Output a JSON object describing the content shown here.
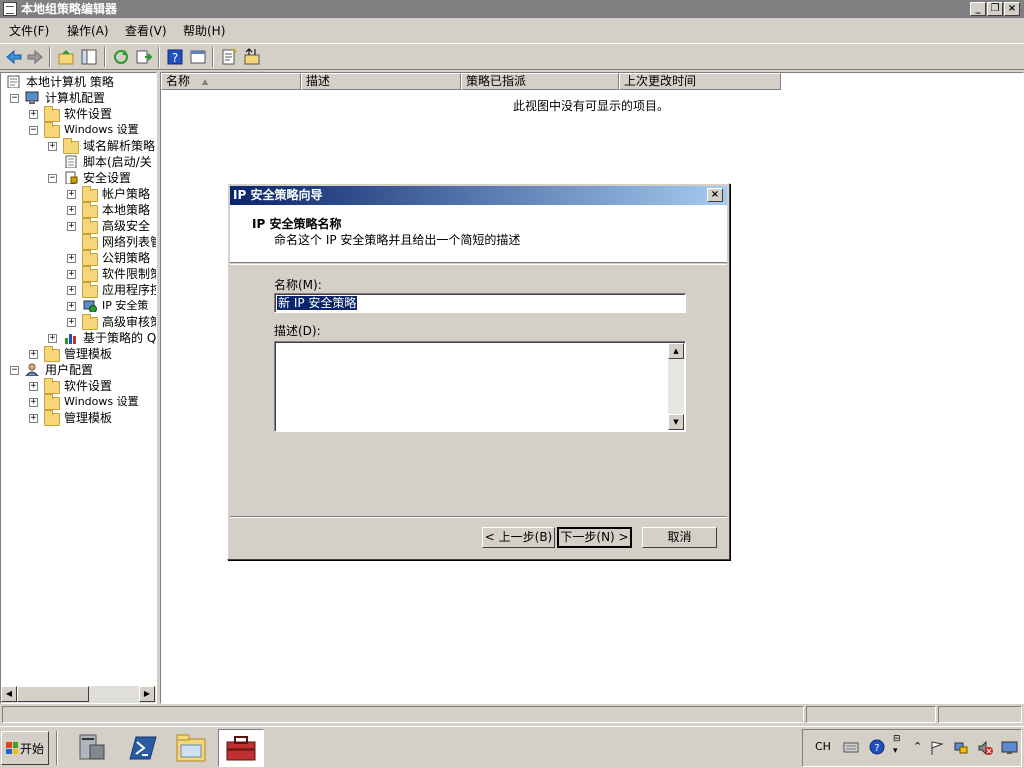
{
  "window": {
    "title": "本地组策略编辑器"
  },
  "menu": [
    "文件(F)",
    "操作(A)",
    "查看(V)",
    "帮助(H)"
  ],
  "tree": {
    "root": "本地计算机 策略",
    "items": [
      {
        "label": "计算机配置",
        "toggle": "−"
      },
      {
        "label": "软件设置",
        "toggle": "+"
      },
      {
        "label": "Windows 设置",
        "toggle": "−"
      },
      {
        "label": "域名解析策略",
        "toggle": "+"
      },
      {
        "label": "脚本(启动/关",
        "toggle": ""
      },
      {
        "label": "安全设置",
        "toggle": "−"
      },
      {
        "label": "帐户策略",
        "toggle": "+"
      },
      {
        "label": "本地策略",
        "toggle": "+"
      },
      {
        "label": "高级安全",
        "toggle": "+"
      },
      {
        "label": "网络列表管",
        "toggle": ""
      },
      {
        "label": "公钥策略",
        "toggle": "+"
      },
      {
        "label": "软件限制策",
        "toggle": "+"
      },
      {
        "label": "应用程序控",
        "toggle": "+"
      },
      {
        "label": "IP 安全策",
        "toggle": "+"
      },
      {
        "label": "高级审核策",
        "toggle": "+"
      },
      {
        "label": "基于策略的 Q",
        "toggle": "+"
      },
      {
        "label": "管理模板",
        "toggle": "+"
      },
      {
        "label": "用户配置",
        "toggle": "−"
      },
      {
        "label": "软件设置",
        "toggle": "+"
      },
      {
        "label": "Windows 设置",
        "toggle": "+"
      },
      {
        "label": "管理模板",
        "toggle": "+"
      }
    ]
  },
  "list": {
    "columns": [
      "名称",
      "描述",
      "策略已指派",
      "上次更改时间"
    ],
    "empty_message": "此视图中没有可显示的项目。"
  },
  "dialog": {
    "title": "IP 安全策略向导",
    "heading": "IP 安全策略名称",
    "subheading": "命名这个 IP 安全策略并且给出一个简短的描述",
    "name_label": "名称(M):",
    "name_value": "新 IP 安全策略",
    "desc_label": "描述(D):",
    "back_button": "< 上一步(B)",
    "next_button": "下一步(N) >",
    "cancel_button": "取消"
  },
  "taskbar": {
    "start_label": "开始",
    "lang": "CH"
  },
  "colors": {
    "title_active": "#0a246a",
    "title_inactive": "#808080",
    "selection": "#0a246a"
  }
}
